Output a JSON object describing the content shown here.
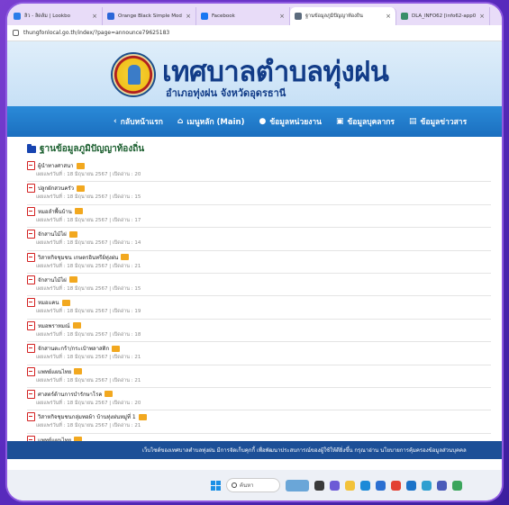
{
  "browser": {
    "tabs": [
      {
        "label": "ลิว - ลิดล้ม | Lookbo",
        "icon_color": "#2b7de9",
        "active": false
      },
      {
        "label": "Orange Black Simple Modern",
        "icon_color": "#2b66d8",
        "active": false
      },
      {
        "label": "Facebook",
        "icon_color": "#1877f2",
        "active": false
      },
      {
        "label": "ฐานข้อมูลภูมิปัญญาท้องถิ่น",
        "icon_color": "#5b6b7d",
        "active": true
      },
      {
        "label": "DLA_INFO62 [info62-app02]",
        "icon_color": "#3a8f6a",
        "active": false
      }
    ],
    "close_glyph": "×",
    "url": "thungfonlocal.go.th/index/?page=announce79625183"
  },
  "header": {
    "title": "เทศบาลตำบลทุ่งฝน",
    "subtitle": "อำเภอทุ่งฝน จังหวัดอุดรธานี"
  },
  "nav": {
    "items": [
      {
        "icon": "‹",
        "label": "กลับหน้าแรก"
      },
      {
        "icon": "⌂",
        "label": "เมนูหลัก (Main)"
      },
      {
        "icon": "●",
        "label": "ข้อมูลหน่วยงาน"
      },
      {
        "icon": "▣",
        "label": "ข้อมูลบุคลากร"
      },
      {
        "icon": "▤",
        "label": "ข้อมูลข่าวสาร"
      }
    ]
  },
  "section": {
    "title": "ฐานข้อมูลภูมิปัญญาท้องถิ่น"
  },
  "items": [
    {
      "title": "ผู้นำทางศาสนา",
      "meta": "เผยแพร่วันที่ : 18 มิถุนายน 2567 | เปิดอ่าน : 20"
    },
    {
      "title": "ปลูกผักสวนครัว",
      "meta": "เผยแพร่วันที่ : 18 มิถุนายน 2567 | เปิดอ่าน : 15"
    },
    {
      "title": "หมอลำพื้นบ้าน",
      "meta": "เผยแพร่วันที่ : 18 มิถุนายน 2567 | เปิดอ่าน : 17"
    },
    {
      "title": "จักสานไม้ไผ่",
      "meta": "เผยแพร่วันที่ : 18 มิถุนายน 2567 | เปิดอ่าน : 14"
    },
    {
      "title": "วิสาหกิจชุมชน เกษตรอินทรีย์ทุ่งฝน",
      "meta": "เผยแพร่วันที่ : 18 มิถุนายน 2567 | เปิดอ่าน : 21"
    },
    {
      "title": "จักสานไม้ไผ่",
      "meta": "เผยแพร่วันที่ : 18 มิถุนายน 2567 | เปิดอ่าน : 15"
    },
    {
      "title": "หมอแคน",
      "meta": "เผยแพร่วันที่ : 18 มิถุนายน 2567 | เปิดอ่าน : 19"
    },
    {
      "title": "หมอพราหมณ์",
      "meta": "เผยแพร่วันที่ : 18 มิถุนายน 2567 | เปิดอ่าน : 18"
    },
    {
      "title": "จักสานตะกร้า/กระเป๋าพลาสติก",
      "meta": "เผยแพร่วันที่ : 18 มิถุนายน 2567 | เปิดอ่าน : 21"
    },
    {
      "title": "แพทย์แผนไทย",
      "meta": "เผยแพร่วันที่ : 18 มิถุนายน 2567 | เปิดอ่าน : 21"
    },
    {
      "title": "ศาสตร์ด้านการบำรักษาโรค",
      "meta": "เผยแพร่วันที่ : 18 มิถุนายน 2567 | เปิดอ่าน : 20"
    },
    {
      "title": "วิสาหกิจชุมชนกลุ่มทอผ้า บ้านทุ่งฝนหมู่ที่ 1",
      "meta": "เผยแพร่วันที่ : 18 มิถุนายน 2567 | เปิดอ่าน : 21"
    },
    {
      "title": "แพทย์แผนไทย",
      "meta": ""
    }
  ],
  "footer": {
    "text": "เว็บไซต์ของเทศบาลตำบลทุ่งฝน มีการจัดเก็บคุกกี้ เพื่อพัฒนาประสบการณ์ของผู้ใช้ให้ดียิ่งขึ้น กรุณาอ่าน นโยบายการคุ้มครองข้อมูลส่วนบุคคล"
  },
  "taskbar": {
    "search_placeholder": "ค้นหา",
    "apps": [
      {
        "name": "landscape-app",
        "color": "#6aa6d8"
      },
      {
        "name": "widgets",
        "color": "#3a3a3a"
      },
      {
        "name": "copilot",
        "color": "#6d5ad6"
      },
      {
        "name": "file-explorer",
        "color": "#f2c23a"
      },
      {
        "name": "edge",
        "color": "#1c8ad8"
      },
      {
        "name": "store",
        "color": "#2b6fd1"
      },
      {
        "name": "chrome",
        "color": "#e34133"
      },
      {
        "name": "mail",
        "color": "#1b73c9"
      },
      {
        "name": "photos",
        "color": "#2f9fd0"
      },
      {
        "name": "teams",
        "color": "#4a5bb9"
      },
      {
        "name": "chrome-2",
        "color": "#3ba55c"
      }
    ]
  }
}
